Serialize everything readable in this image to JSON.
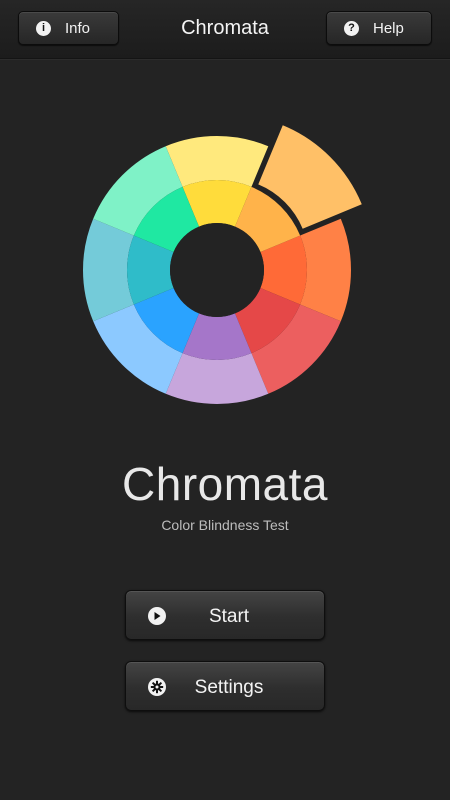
{
  "header": {
    "title": "Chromata",
    "info_label": "Info",
    "help_label": "Help",
    "info_icon": "info-icon",
    "help_icon": "help-icon"
  },
  "logo": {
    "icon": "color-wheel-icon",
    "colors": {
      "outer": [
        "#ffe97d",
        "#ffc067",
        "#ff8146",
        "#ec5f5f",
        "#c7a6dc",
        "#8cc9ff",
        "#74cbd9",
        "#7ff2c7"
      ],
      "inner": [
        "#ffdc3b",
        "#ffb34a",
        "#ff6a37",
        "#e54848",
        "#a576c9",
        "#2aa3ff",
        "#2fbcc9",
        "#1fe8a2"
      ]
    }
  },
  "main": {
    "title": "Chromata",
    "subtitle": "Color Blindness Test",
    "start_label": "Start",
    "settings_label": "Settings",
    "start_icon": "play-icon",
    "settings_icon": "gear-icon"
  }
}
